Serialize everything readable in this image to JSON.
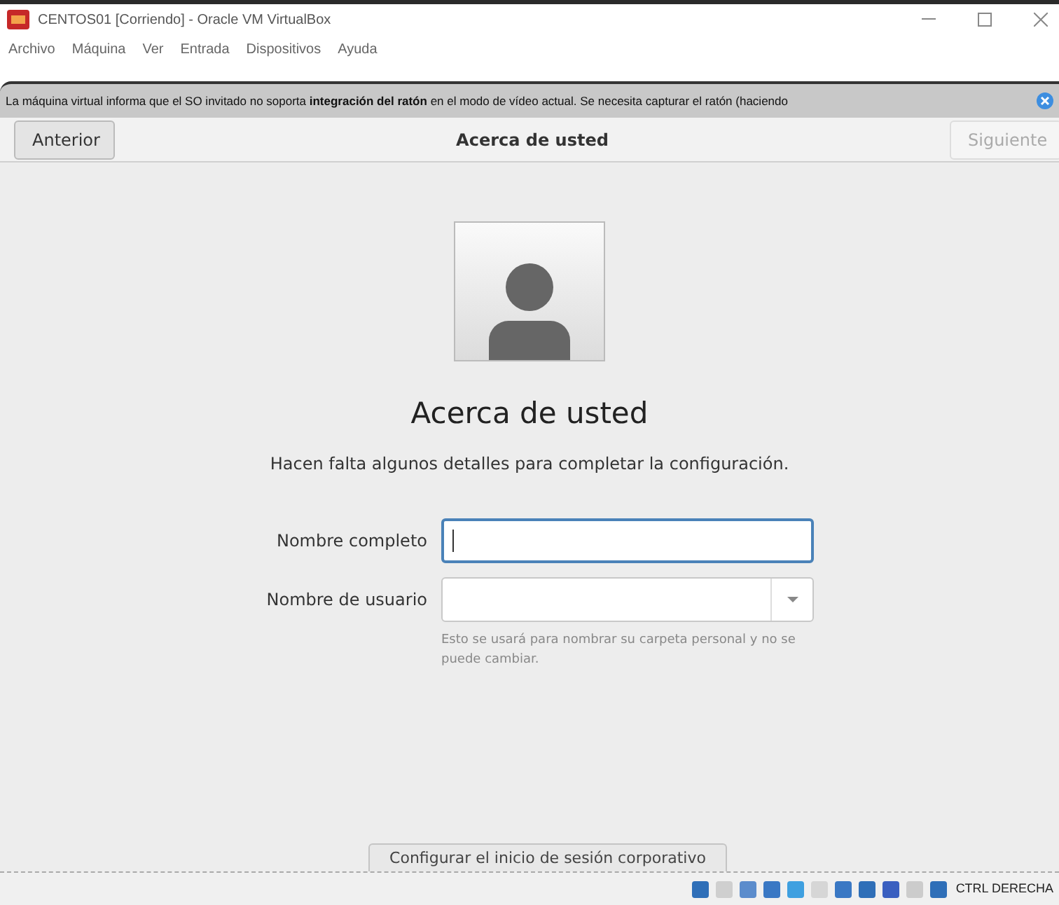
{
  "window": {
    "title": "CENTOS01 [Corriendo] - Oracle VM VirtualBox"
  },
  "menu": [
    "Archivo",
    "Máquina",
    "Ver",
    "Entrada",
    "Dispositivos",
    "Ayuda"
  ],
  "notification": {
    "text": "La máquina virtual informa que el SO invitado no soporta **integración del ratón** en el modo de vídeo actual. Se necesita capturar el ratón (haciendo"
  },
  "header": {
    "back": {
      "label": "Anterior",
      "disabled": false
    },
    "title": "Acerca de usted",
    "next": {
      "label": "Siguiente",
      "disabled": true
    }
  },
  "heading": "Acerca de usted",
  "subtitle": "Hacen falta algunos detalles para completar la configuración.",
  "fields": [
    {
      "kind": "text",
      "label": "Nombre completo",
      "focused": true
    },
    {
      "kind": "combo",
      "label": "Nombre de usuario",
      "focused": false,
      "hint": "Esto se usará para nombrar su carpeta personal y no se puede cambiar."
    }
  ],
  "corporate_button": "Configurar el inicio de sesión corporativo",
  "status_bar": {
    "host_key": "CTRL DERECHA"
  }
}
